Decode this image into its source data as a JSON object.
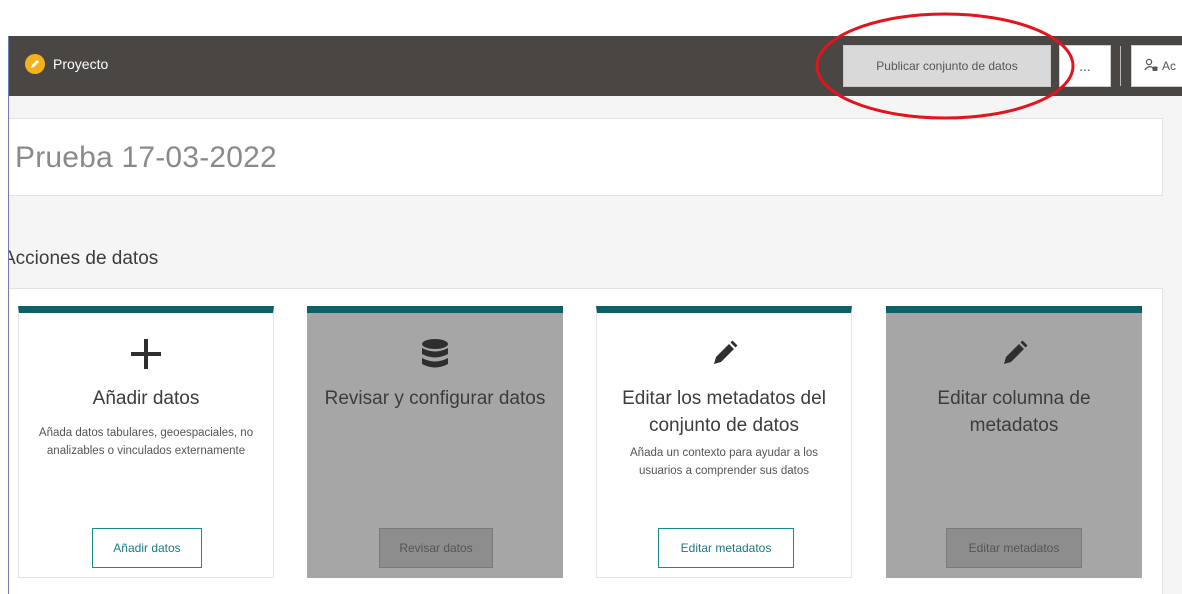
{
  "topbar": {
    "brand_label": "Proyecto",
    "publish_label": "Publicar conjunto de datos",
    "more_label": "...",
    "access_label": "Ac"
  },
  "page": {
    "title": "Prueba 17-03-2022",
    "section_title": "Acciones de datos"
  },
  "cards": [
    {
      "icon": "plus-icon",
      "title": "Añadir datos",
      "description": "Añada datos tabulares, geoespaciales, no analizables o vinculados externamente",
      "button_label": "Añadir datos",
      "enabled": true
    },
    {
      "icon": "database-icon",
      "title": "Revisar y configurar datos",
      "description": "",
      "button_label": "Revisar datos",
      "enabled": false
    },
    {
      "icon": "pencil-icon",
      "title": "Editar los metadatos del conjunto de datos",
      "description": "Añada un contexto para ayudar a los usuarios a comprender sus datos",
      "button_label": "Editar metadatos",
      "enabled": true
    },
    {
      "icon": "pencil-icon",
      "title": "Editar columna de metadatos",
      "description": "",
      "button_label": "Editar metadatos",
      "enabled": false
    }
  ],
  "colors": {
    "topbar": "#4a4644",
    "card_accent": "#0f5f66",
    "brand_icon": "#f3b21b",
    "annotation": "#e2141c"
  }
}
